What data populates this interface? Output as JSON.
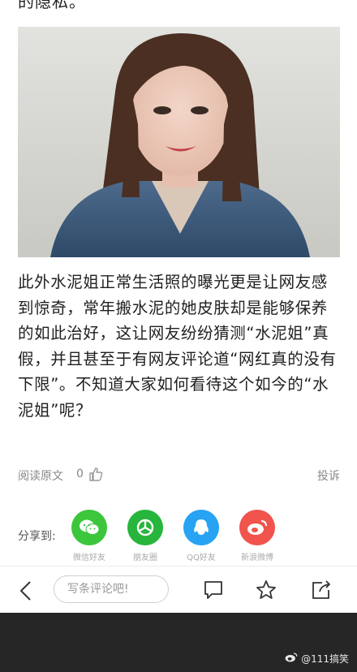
{
  "top_text": "的隐私。",
  "article": {
    "paragraph": "此外水泥姐正常生活照的曝光更是让网友感到惊奇，常年搬水泥的她皮肤却是能够保养的如此治好，这让网友纷纷猜测“水泥姐”真假，并且甚至于有网友评论道“网红真的没有下限”。不知道大家如何看待这个如今的“水泥姐”呢？"
  },
  "meta": {
    "read_original": "阅读原文",
    "like_count": "0",
    "report": "投诉"
  },
  "share": {
    "label": "分享到:",
    "items": [
      {
        "name": "微信好友",
        "icon": "wechat-icon",
        "color": "#3cc63c"
      },
      {
        "name": "朋友圈",
        "icon": "moments-icon",
        "color": "#27b53c"
      },
      {
        "name": "QQ好友",
        "icon": "qq-icon",
        "color": "#27a3f3"
      },
      {
        "name": "新浪微博",
        "icon": "weibo-icon",
        "color": "#f0544c"
      }
    ]
  },
  "toolbar": {
    "comment_placeholder": "写条评论吧!"
  },
  "watermark": "@111搞笑",
  "colors": {
    "bottom_bar": "#262626"
  }
}
